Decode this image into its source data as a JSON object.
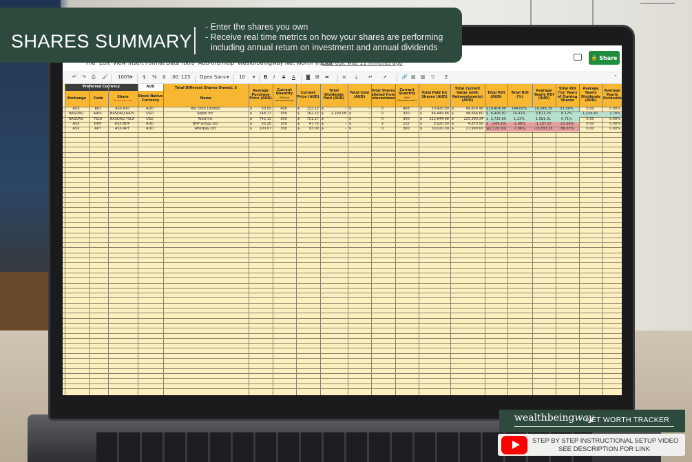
{
  "banner": {
    "title": "SHARES SUMMARY",
    "bullets": [
      "- Enter the shares you own",
      "- Receive real time metrics on how your shares are performing including annual return on investment and annual dividends"
    ],
    "bg_color": "#2e4a3c"
  },
  "sheets": {
    "menu": [
      "File",
      "Edit",
      "View",
      "Insert",
      "Format",
      "Data",
      "Tools",
      "Add-ons",
      "Help"
    ],
    "doc_title": "Wealthbeingway Net Worth Tracker",
    "last_edit": "Last edit was 11 minutes ago",
    "share_label": "Share",
    "share_color": "#1e8e3e",
    "toolbar": {
      "zoom": "100%",
      "currency": "$",
      "percent": "%",
      "dec_less": ".0",
      "dec_more": ".00",
      "format_more": "123",
      "font": "Open Sans",
      "font_size": "10",
      "bold": "B",
      "italic": "I",
      "strike": "S",
      "text_color": "A",
      "sum": "Σ"
    }
  },
  "sheet": {
    "preferred_currency_label": "Preferred Currency",
    "preferred_currency_value": "AUD",
    "total_shares_label": "Total Different Shares Owned: 5",
    "headers": {
      "exchange": "Exchange",
      "code": "Code",
      "share": "Share",
      "share_sub": "Exchange:Code",
      "native": "Stock Native Currency",
      "name": "Name",
      "avg_price": "Average Purchase Price (AUD)",
      "qty": "Current Quantity",
      "qty_sub": "(Without reinvestments)",
      "cur_price": "Current Price (AUD)",
      "divs": "Total Dividends Paid (AUD)",
      "sold": "Total Sold (AUD)",
      "allotted": "Total Shares alloted from Reinvestment",
      "qty2": "Current Quantity",
      "qty2_sub": "(With Reinvestments)",
      "paid": "Total Paid for Shares (AUD)",
      "cur_value": "Total Current Value (with Reinvestments) (AUD)",
      "roi": "Total ROI (AUD)",
      "roi_pct": "Total ROI (%)",
      "yearly_roi": "Average Yearly ROI (AUD)",
      "roi_years": "Total ROI (%)/ Years of Owning Shares",
      "yearly_div": "Average Yearly Dividends (AUD)",
      "yearly_div_pct": "Average Yearly Dividends"
    },
    "rows": [
      {
        "exchange": "ASX",
        "code": "RIO",
        "share": "ASX:RIO",
        "native": "AUD",
        "name": "Rio Tinto Limited",
        "avg": "50.05",
        "qty": "408",
        "price": "122.12",
        "divs": "-",
        "sold": "-",
        "allotted": "0",
        "qty2": "408",
        "paid": "20,420.00",
        "value": "49,824.96",
        "roi": "29,404.96",
        "roi_pct": "144.00%",
        "yroi": "16,548.79",
        "roi_years": "81.04%",
        "ydiv": "0.00",
        "ydiv_pct": "0.00%"
      },
      {
        "exchange": "NASDAQ",
        "code": "AAPL",
        "share": "NASDAQ:AAPL",
        "native": "USD",
        "name": "Apple Inc",
        "avg": "148.17",
        "qty": "300",
        "price": "162.22",
        "divs": "2,190.08",
        "sold": "-",
        "allotted": "0",
        "qty2": "300",
        "paid": "44,449.86",
        "value": "48,666.60",
        "roi": "6,406.81",
        "roi_pct": "14.41%",
        "yroi": "3,611.25",
        "roi_years": "8.12%",
        "ydiv": "1,234.45",
        "ydiv_pct": "2.78%"
      },
      {
        "exchange": "NASDAQ",
        "code": "TSLA",
        "share": "NASDAQ:TSLA",
        "native": "USD",
        "name": "Tesla Inc",
        "avg": "742.15",
        "qty": "300",
        "price": "751.27",
        "divs": "-",
        "sold": "-",
        "allotted": "0",
        "qty2": "300",
        "paid": "222,644.68",
        "value": "225,380.34",
        "roi": "2,735.65",
        "roi_pct": "1.23%",
        "yroi": "1,581.01",
        "roi_years": "0.71%",
        "ydiv": "0.00",
        "ydiv_pct": "0.00%"
      },
      {
        "exchange": "ASX",
        "code": "BHP",
        "share": "ASX:BHP",
        "native": "AUD",
        "name": "BHP Group Ltd",
        "avg": "50.20",
        "qty": "100",
        "price": "47.75",
        "divs": "-",
        "sold": "-",
        "allotted": "2",
        "qty2": "102",
        "paid": "5,020.00",
        "value": "4,870.50",
        "roi": "(149.50)",
        "roi_pct": "-2.98%",
        "yroi": "-1,187.57",
        "roi_years": "-23.66%",
        "ydiv": "0.00",
        "ydiv_pct": "0.00%"
      },
      {
        "exchange": "ASX",
        "code": "APT",
        "share": "ASX:APT",
        "native": "AUD",
        "name": "Afterpay Ltd",
        "avg": "100.07",
        "qty": "300",
        "price": "93.00",
        "divs": "-",
        "sold": "-",
        "allotted": "0",
        "qty2": "300",
        "paid": "30,020.00",
        "value": "27,900.00",
        "roi": "(2,120.00)",
        "roi_pct": "-7.06%",
        "yroi": "-16,833.26",
        "roi_years": "-56.07%",
        "ydiv": "0.00",
        "ydiv_pct": "0.00%"
      }
    ],
    "dollar": "$",
    "colors": {
      "header_orange": "#f7b733",
      "cell_cream": "#fcefc0",
      "dark_header": "#3c3c3c",
      "positive_green": "#b7e1cd",
      "negative_red": "#e6a0a0"
    }
  },
  "brand": {
    "logo_main": "wealthbeing",
    "logo_italic": "way",
    "tagline": "NET WORTH TRACKER"
  },
  "youtube": {
    "line1": "STEP BY STEP INSTRUCTIONAL SETUP VIDEO",
    "line2": "SEE DESCRIPTION FOR LINK"
  }
}
